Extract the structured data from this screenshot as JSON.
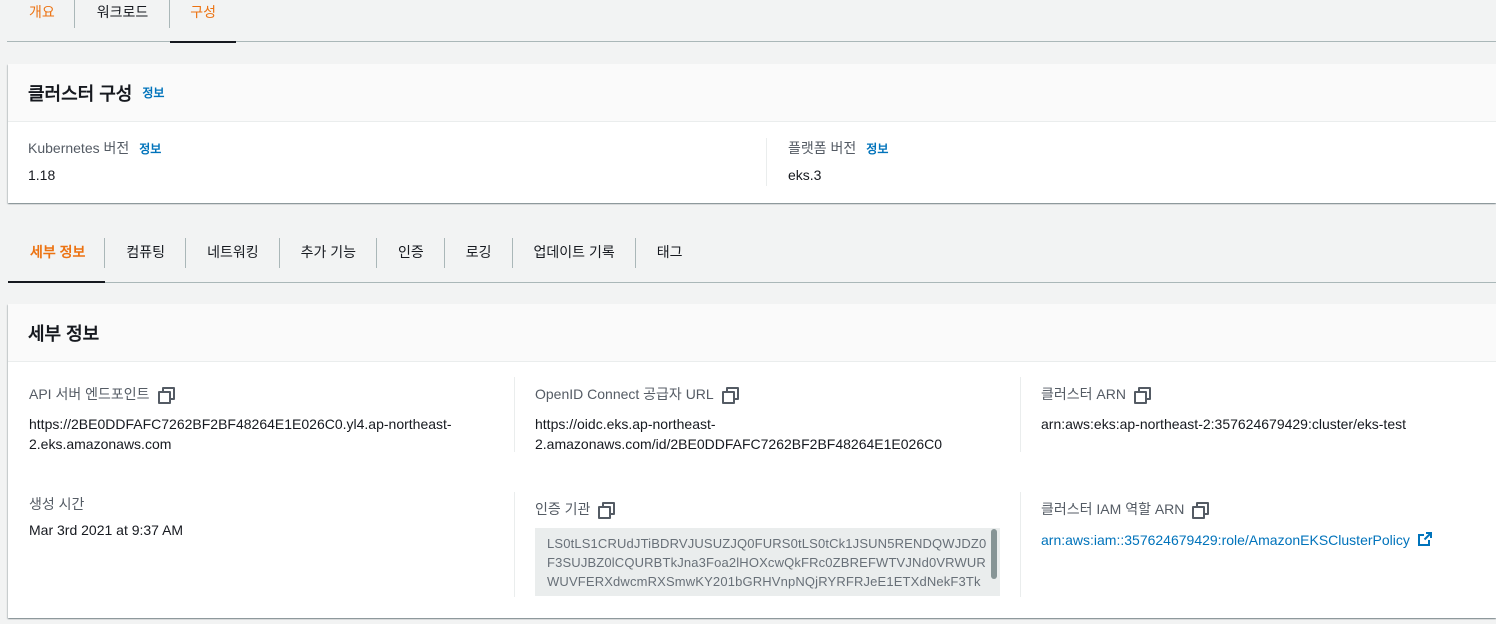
{
  "top_tabs": [
    {
      "label": "개요",
      "active": false
    },
    {
      "label": "워크로드",
      "active": false
    },
    {
      "label": "구성",
      "active": true
    }
  ],
  "cluster_config": {
    "title": "클러스터 구성",
    "info": "정보",
    "kubernetes_version": {
      "label": "Kubernetes 버전",
      "info": "정보",
      "value": "1.18"
    },
    "platform_version": {
      "label": "플랫폼 버전",
      "info": "정보",
      "value": "eks.3"
    }
  },
  "sub_tabs": [
    {
      "label": "세부 정보",
      "active": true
    },
    {
      "label": "컴퓨팅",
      "active": false
    },
    {
      "label": "네트워킹",
      "active": false
    },
    {
      "label": "추가 기능",
      "active": false
    },
    {
      "label": "인증",
      "active": false
    },
    {
      "label": "로깅",
      "active": false
    },
    {
      "label": "업데이트 기록",
      "active": false
    },
    {
      "label": "태그",
      "active": false
    }
  ],
  "details": {
    "title": "세부 정보",
    "api_endpoint": {
      "label": "API 서버 엔드포인트",
      "line1": "https://2BE0DDFAFC7262BF2BF48264E1E026C0.yl4.ap-northeast-",
      "line2": "2.eks.amazonaws.com"
    },
    "oidc_url": {
      "label": "OpenID Connect 공급자 URL",
      "line1": "https://oidc.eks.ap-northeast-",
      "line2": "2.amazonaws.com/id/2BE0DDFAFC7262BF2BF48264E1E026C0"
    },
    "cluster_arn": {
      "label": "클러스터 ARN",
      "value": "arn:aws:eks:ap-northeast-2:357624679429:cluster/eks-test"
    },
    "created": {
      "label": "생성 시간",
      "value": "Mar 3rd 2021 at 9:37 AM"
    },
    "certificate_authority": {
      "label": "인증 기관",
      "value": "LS0tLS1CRUdJTiBDRVJUSUZJQ0FURS0tLS0tCk1JSUN5RENDQWJDZ0F3SUJBZ0lCQURBTkJna3Foa2lHOXcwQkFRc0ZBREFWTVJNd0VRWURWUVFERXdwcmRXSmwKY201bGRHVnpNQjRYRFRJeE1ETXdNekF3Tk"
    },
    "iam_role_arn": {
      "label": "클러스터 IAM 역할 ARN",
      "value": "arn:aws:iam::357624679429:role/AmazonEKSClusterPolicy"
    }
  },
  "colors": {
    "accent": "#ec7211",
    "link": "#0073bb",
    "text": "#16191f",
    "muted": "#545b64"
  }
}
